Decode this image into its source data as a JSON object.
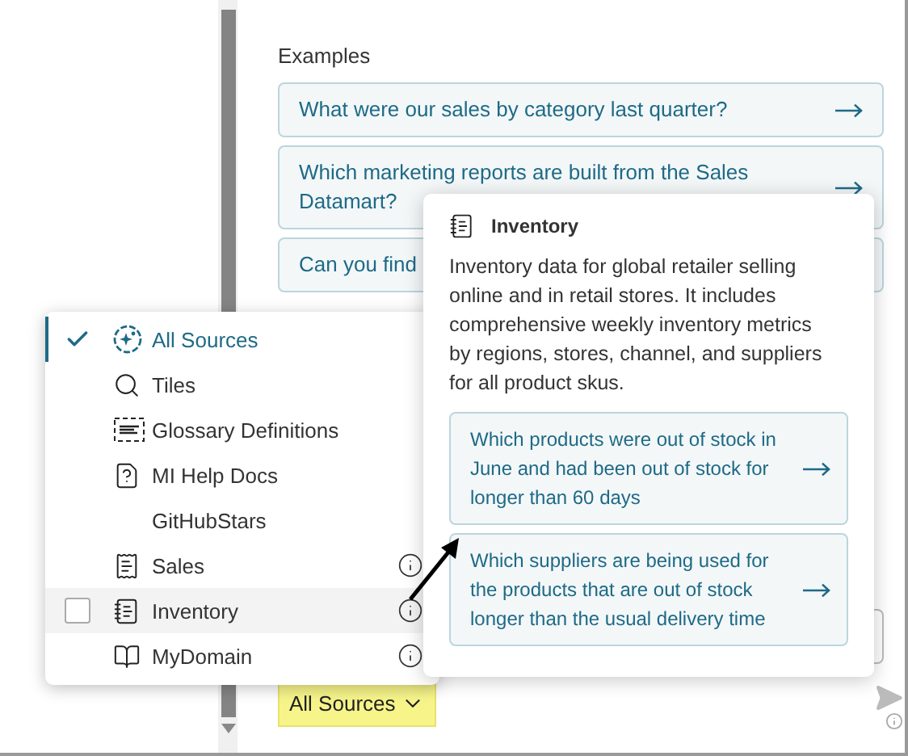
{
  "examples": {
    "heading": "Examples",
    "items": [
      {
        "text": "What were our sales by category last quarter?",
        "arrow": true
      },
      {
        "text": "Which marketing reports are built from the Sales Datamart?",
        "arrow": true
      },
      {
        "text": "Can you find",
        "arrow": false
      }
    ]
  },
  "source_menu": {
    "items": [
      {
        "label": "All Sources",
        "selected": true,
        "highlighted": false,
        "info": false
      },
      {
        "label": "Tiles",
        "selected": false,
        "highlighted": false,
        "info": false
      },
      {
        "label": "Glossary Definitions",
        "selected": false,
        "highlighted": false,
        "info": false
      },
      {
        "label": "MI Help Docs",
        "selected": false,
        "highlighted": false,
        "info": false
      },
      {
        "label": "GitHubStars",
        "selected": false,
        "highlighted": false,
        "info": false
      },
      {
        "label": "Sales",
        "selected": false,
        "highlighted": false,
        "info": true
      },
      {
        "label": "Inventory",
        "selected": false,
        "highlighted": true,
        "info": true
      },
      {
        "label": "MyDomain",
        "selected": false,
        "highlighted": false,
        "info": true
      }
    ]
  },
  "source_info": {
    "title": "Inventory",
    "description": "Inventory data for global retailer selling online and in retail stores. It includes comprehensive weekly inventory metrics by regions, stores, channel, and suppliers for all product skus.",
    "suggestions": [
      {
        "text": "Which products were out of stock in June and had been out of stock for longer than 60 days"
      },
      {
        "text": "Which suppliers are being used for the products that are out of stock longer than the usual delivery time"
      }
    ]
  },
  "source_button": {
    "label": "All Sources"
  }
}
